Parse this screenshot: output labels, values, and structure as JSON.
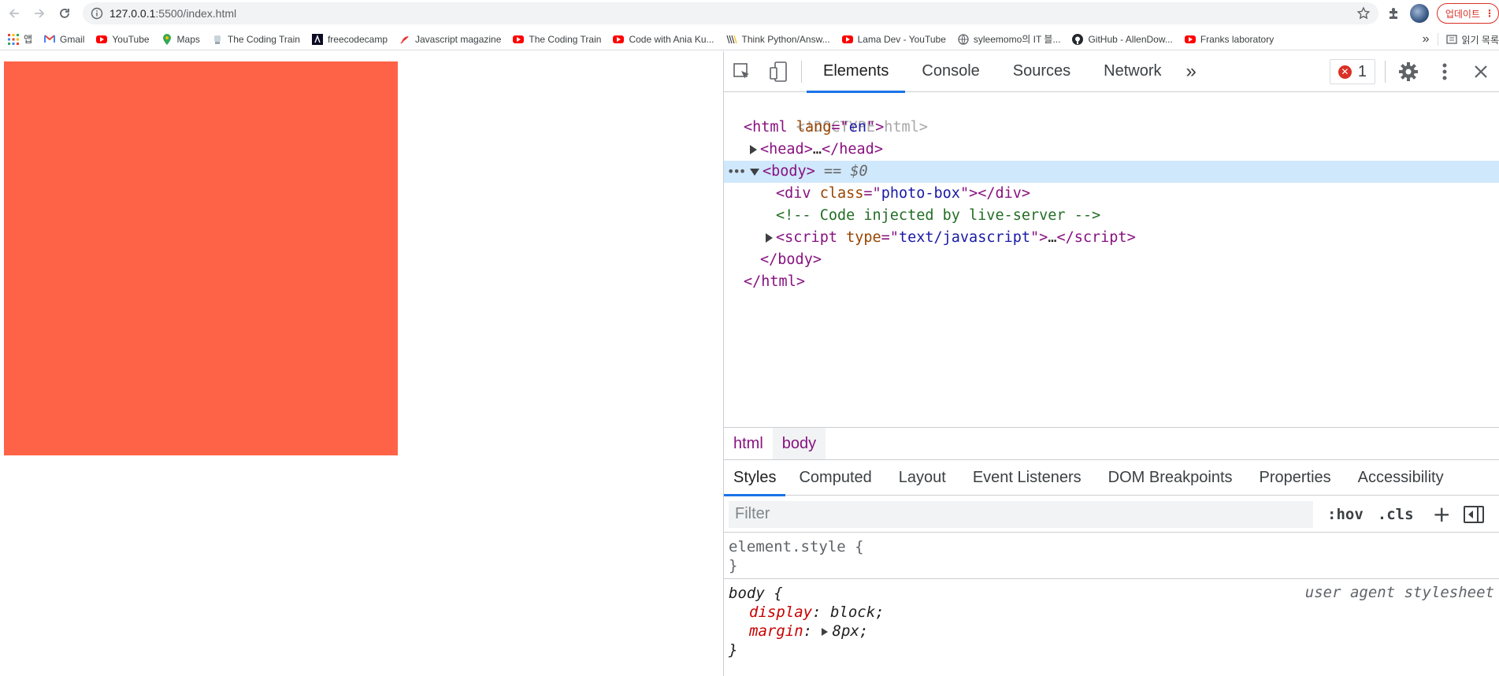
{
  "browser": {
    "url_host": "127.0.0.1",
    "url_rest": ":5500/index.html",
    "update_label": "업데이트"
  },
  "bookmarks": {
    "apps_label": "앱",
    "items": [
      {
        "label": "Gmail",
        "icon": "gmail-icon"
      },
      {
        "label": "YouTube",
        "icon": "youtube-icon"
      },
      {
        "label": "Maps",
        "icon": "maps-icon"
      },
      {
        "label": "The Coding Train",
        "icon": "coding-train-icon"
      },
      {
        "label": "freecodecamp",
        "icon": "freecodecamp-icon"
      },
      {
        "label": "Javascript magazine",
        "icon": "js-magazine-icon"
      },
      {
        "label": "The Coding Train",
        "icon": "youtube-icon"
      },
      {
        "label": "Code with Ania Ku...",
        "icon": "youtube-icon"
      },
      {
        "label": "Think Python/Answ...",
        "icon": "book-icon"
      },
      {
        "label": "Lama Dev - YouTube",
        "icon": "youtube-icon"
      },
      {
        "label": "syleemomo의 IT 블...",
        "icon": "globe-icon"
      },
      {
        "label": "GitHub - AllenDow...",
        "icon": "github-icon"
      },
      {
        "label": "Franks laboratory",
        "icon": "youtube-icon"
      }
    ],
    "overflow": "»",
    "reading_list": "읽기 목록"
  },
  "page": {
    "photo_box_color": "#ff6347"
  },
  "devtools": {
    "tabs": [
      "Elements",
      "Console",
      "Sources",
      "Network"
    ],
    "more_tabs": "»",
    "error_count": "1",
    "elements": {
      "doctype": "<!DOCTYPE html>",
      "html_open_tag": "html",
      "html_lang_attr": "lang",
      "html_lang_val": "en",
      "head_tag": "head",
      "body_tag": "body",
      "body_marker": "== $0",
      "div_tag": "div",
      "div_class_attr": "class",
      "div_class_val": "photo-box",
      "comment": "<!-- Code injected by live-server -->",
      "script_tag": "script",
      "script_type_attr": "type",
      "script_type_val": "text/javascript",
      "ellipsis": "…"
    },
    "breadcrumbs": [
      "html",
      "body"
    ],
    "sub_tabs": [
      "Styles",
      "Computed",
      "Layout",
      "Event Listeners",
      "DOM Breakpoints",
      "Properties",
      "Accessibility"
    ],
    "filter": {
      "placeholder": "Filter",
      "hov": ":hov",
      "cls": ".cls",
      "plus": "+"
    },
    "styles": {
      "element_style_selector": "element.style {",
      "close_brace": "}",
      "body_selector": "body {",
      "origin": "user agent stylesheet",
      "props": [
        {
          "name": "display",
          "value": "block;"
        },
        {
          "name": "margin",
          "value": "8px;"
        }
      ]
    }
  }
}
